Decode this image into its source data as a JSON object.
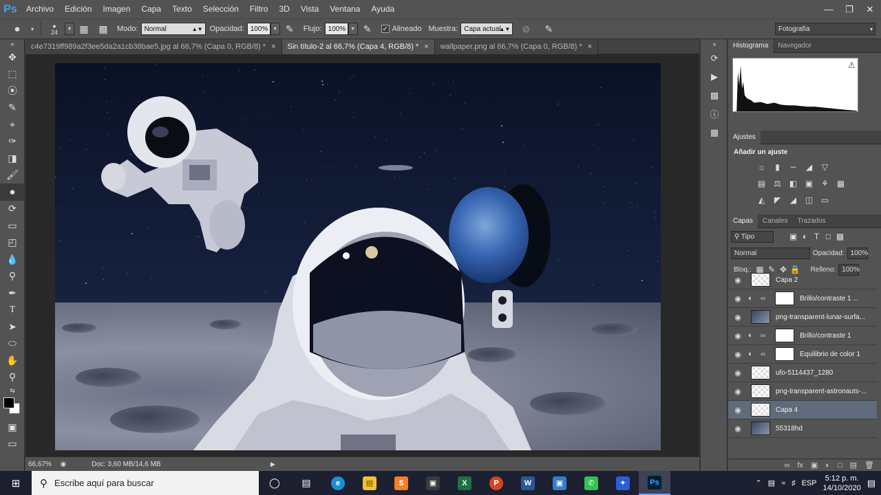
{
  "app": {
    "logo": "Ps"
  },
  "menu": [
    "Archivo",
    "Edición",
    "Imagen",
    "Capa",
    "Texto",
    "Selección",
    "Filtro",
    "3D",
    "Vista",
    "Ventana",
    "Ayuda"
  ],
  "options": {
    "brush_size": "24",
    "mode_label": "Modo:",
    "mode_value": "Normal",
    "opacity_label": "Opacidad:",
    "opacity_value": "100%",
    "flow_label": "Flujo:",
    "flow_value": "100%",
    "aligned_label": "Alineado",
    "aligned_checked": true,
    "sample_label": "Muestra:",
    "sample_value": "Capa actual",
    "workspace": "Fotografía"
  },
  "tabs": [
    {
      "label": "c4e7319ff989a2f3ee5da2a1cb38bae5.jpg al 66,7% (Capa 0, RGB/8) *",
      "active": false
    },
    {
      "label": "Sin título-2 al 66,7% (Capa 4, RGB/8) *",
      "active": true
    },
    {
      "label": "wallpaper.png al 66,7% (Capa 0, RGB/8) *",
      "active": false
    }
  ],
  "status": {
    "zoom": "66,67%",
    "doc": "Doc: 3,60 MB/14,6 MB"
  },
  "panels": {
    "histogram_tab": "Histograma",
    "navigator_tab": "Navegador",
    "adjustments_tab": "Ajustes",
    "adjustments_title": "Añadir un ajuste",
    "layers_tab": "Capas",
    "channels_tab": "Canales",
    "paths_tab": "Trazados",
    "kind_filter": "Tipo",
    "blend_mode": "Normal",
    "opacity_label": "Opacidad:",
    "opacity_value": "100%",
    "lock_label": "Bloq.:",
    "fill_label": "Relleno:",
    "fill_value": "100%"
  },
  "layers": [
    {
      "name": "Capa 2",
      "type": "transparent",
      "selected": false
    },
    {
      "name": "Brillo/contraste 1 ...",
      "type": "adjustment",
      "selected": false
    },
    {
      "name": "png-transparent-lunar-surfa...",
      "type": "image",
      "selected": false
    },
    {
      "name": "Brillo/contraste 1",
      "type": "adjustment",
      "selected": false
    },
    {
      "name": "Equilibrio de color 1",
      "type": "adjustment",
      "selected": false
    },
    {
      "name": "ufo-5114437_1280",
      "type": "transparent",
      "selected": false
    },
    {
      "name": "png-transparent-astronauts-...",
      "type": "transparent",
      "selected": false
    },
    {
      "name": "Capa 4",
      "type": "transparent",
      "selected": true
    },
    {
      "name": "55318hd",
      "type": "image",
      "selected": false
    }
  ],
  "taskbar": {
    "search_placeholder": "Escribe aquí para buscar",
    "lang": "ESP",
    "time": "5:12 p. m.",
    "date": "14/10/2020"
  }
}
